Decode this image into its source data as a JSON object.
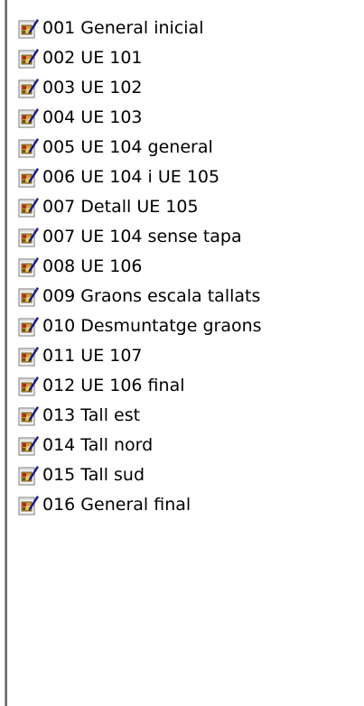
{
  "list": {
    "icon": "image-document-icon",
    "items": [
      {
        "label": "001 General inicial"
      },
      {
        "label": "002 UE 101"
      },
      {
        "label": "003 UE 102"
      },
      {
        "label": "004 UE 103"
      },
      {
        "label": "005 UE 104 general"
      },
      {
        "label": "006 UE 104 i UE 105"
      },
      {
        "label": "007 Detall UE 105"
      },
      {
        "label": "007 UE 104 sense tapa"
      },
      {
        "label": "008 UE 106"
      },
      {
        "label": "009 Graons escala tallats"
      },
      {
        "label": "010 Desmuntatge graons"
      },
      {
        "label": "011 UE 107"
      },
      {
        "label": "012 UE 106 final"
      },
      {
        "label": "013 Tall est"
      },
      {
        "label": "014 Tall nord"
      },
      {
        "label": "015 Tall sud"
      },
      {
        "label": "016 General final"
      }
    ]
  },
  "colors": {
    "text": "#000000",
    "background": "#ffffff",
    "pane_border": "#6b6b6b",
    "icon_page": "#f4f4f4",
    "icon_picture": "#c8a040",
    "icon_accent_red": "#c02020",
    "icon_pen": "#1a1a8c"
  }
}
